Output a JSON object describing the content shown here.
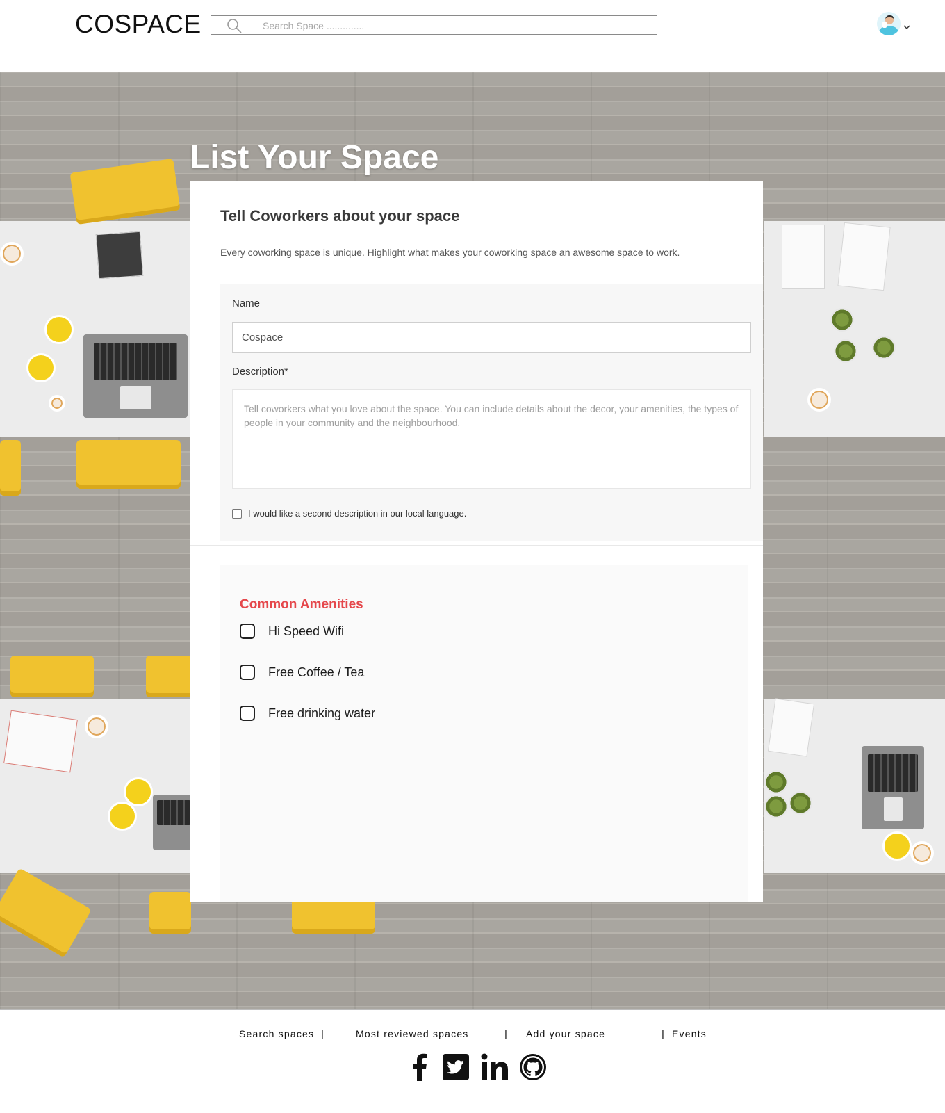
{
  "header": {
    "logo": "COSPACE",
    "search_placeholder": "Search Space ..............",
    "icons": {
      "search": "search-icon",
      "avatar": "user-avatar",
      "dropdown": "chevron-down-icon"
    }
  },
  "hero": {
    "title": "List Your Space"
  },
  "form": {
    "section_title": "Tell Coworkers about your space",
    "section_subtitle": "Every coworking space is unique. Highlight what makes your coworking space an awesome space to work.",
    "name_label": "Name",
    "name_value": "Cospace",
    "description_label": "Description*",
    "description_placeholder": "Tell coworkers what you love about the space. You can include details about the decor, your amenities, the types of people in your community and the neighbourhood.",
    "local_language_label": "I would like a second description in our local language.",
    "local_language_checked": false
  },
  "amenities": {
    "title": "Common Amenities",
    "title_color": "#e5474b",
    "items": [
      {
        "label": "Hi Speed Wifi",
        "checked": false
      },
      {
        "label": "Free Coffee / Tea",
        "checked": false
      },
      {
        "label": "Free drinking water",
        "checked": false
      }
    ]
  },
  "footer": {
    "links": [
      "Search spaces",
      "Most reviewed spaces",
      "Add your space",
      "Events"
    ],
    "separator": "|",
    "social_icons": [
      "facebook-icon",
      "twitter-icon",
      "linkedin-icon",
      "github-icon"
    ]
  }
}
